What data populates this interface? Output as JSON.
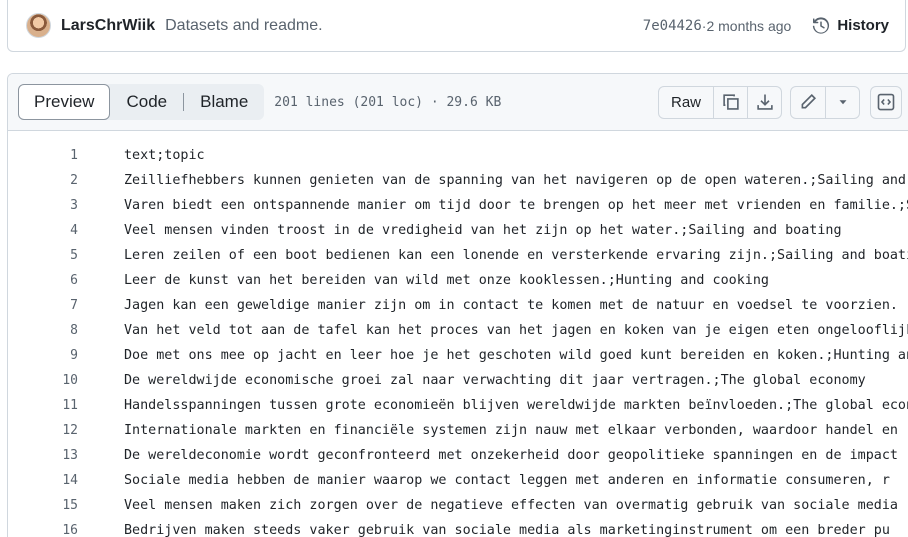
{
  "commit": {
    "author": "LarsChrWiik",
    "message": "Datasets and readme.",
    "sha": "7e04426",
    "separator": " · ",
    "time": "2 months ago",
    "history_label": "History"
  },
  "file_header": {
    "tabs": [
      "Preview",
      "Code",
      "Blame"
    ],
    "active_tab": "Preview",
    "stats": "201 lines (201 loc) · 29.6 KB",
    "raw_label": "Raw"
  },
  "icons": {
    "history": "history-icon",
    "copy": "copy-icon",
    "download": "download-icon",
    "edit": "pencil-icon",
    "more": "triangle-down-icon",
    "symbols": "code-square-icon"
  },
  "colors": {
    "border": "#d0d7de",
    "muted": "#59636e",
    "text": "#1f2328",
    "header_bg": "#f6f8fa"
  },
  "lines": [
    {
      "n": "1",
      "t": "text;topic"
    },
    {
      "n": "2",
      "t": "Zeilliefhebbers kunnen genieten van de spanning van het navigeren op de open wateren.;Sailing and boating"
    },
    {
      "n": "3",
      "t": "Varen biedt een ontspannende manier om tijd door te brengen op het meer met vrienden en familie.;Sailing and boating"
    },
    {
      "n": "4",
      "t": "Veel mensen vinden troost in de vredigheid van het zijn op het water.;Sailing and boating"
    },
    {
      "n": "5",
      "t": "Leren zeilen of een boot bedienen kan een lonende en versterkende ervaring zijn.;Sailing and boating"
    },
    {
      "n": "6",
      "t": "Leer de kunst van het bereiden van wild met onze kooklessen.;Hunting and cooking"
    },
    {
      "n": "7",
      "t": "Jagen kan een geweldige manier zijn om in contact te komen met de natuur en voedsel te voorzien."
    },
    {
      "n": "8",
      "t": "Van het veld tot aan de tafel kan het proces van het jagen en koken van je eigen eten ongelooflijk"
    },
    {
      "n": "9",
      "t": "Doe met ons mee op jacht en leer hoe je het geschoten wild goed kunt bereiden en koken.;Hunting and cooking"
    },
    {
      "n": "10",
      "t": "De wereldwijde economische groei zal naar verwachting dit jaar vertragen.;The global economy"
    },
    {
      "n": "11",
      "t": "Handelsspanningen tussen grote economieën blijven wereldwijde markten beïnvloeden.;The global economy"
    },
    {
      "n": "12",
      "t": "Internationale markten en financiële systemen zijn nauw met elkaar verbonden, waardoor handel en"
    },
    {
      "n": "13",
      "t": "De wereldeconomie wordt geconfronteerd met onzekerheid door geopolitieke spanningen en de impact"
    },
    {
      "n": "14",
      "t": "Sociale media hebben de manier waarop we contact leggen met anderen en informatie consumeren, r"
    },
    {
      "n": "15",
      "t": "Veel mensen maken zich zorgen over de negatieve effecten van overmatig gebruik van sociale media"
    },
    {
      "n": "16",
      "t": "Bedrijven maken steeds vaker gebruik van sociale media als marketinginstrument om een breder pu"
    }
  ]
}
